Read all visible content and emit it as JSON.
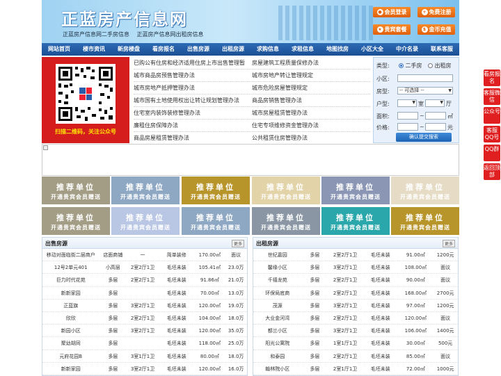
{
  "header": {
    "title": "正蓝房产信息网",
    "sublinks": [
      "正蓝房产信息网二手房信息",
      "正蓝房产信息网出租房信息"
    ],
    "buttons": [
      "会员登录",
      "免费注册",
      "贵宾套餐",
      "金币充值"
    ]
  },
  "nav": [
    "网站首页",
    "楼市资讯",
    "新房楼盘",
    "看房报名",
    "出售房源",
    "出租房源",
    "求购信息",
    "求租信息",
    "地图找房",
    "小区大全",
    "中介名录",
    "联系客服"
  ],
  "qr_caption": "扫描二维码，关注公众号",
  "links": [
    [
      "已购公有住房和经济适用住房上市出售管理暂",
      "房屋建筑工程质量保修办法"
    ],
    [
      "城市商品房预售管理办法",
      "城市房地产转让管理规定"
    ],
    [
      "城市房地产抵押管理办法",
      "城市危险房屋管理规定"
    ],
    [
      "城市国有土地使用权出让转让规划管理办法",
      "商品房销售管理办法"
    ],
    [
      "住宅室内装饰装修管理办法",
      "城市房屋租赁管理办法"
    ],
    [
      "廉租住房保障办法",
      "住宅专项维修资金管理办法"
    ],
    [
      "商品房屋租赁管理办法",
      "公共租赁住房管理办法"
    ]
  ],
  "search": {
    "type_label": "类型:",
    "radio1": "二手房",
    "radio2": "出租房",
    "community_label": "小区:",
    "layout_label": "房型:",
    "layout_value": "-- 可选择 --",
    "unit_label": "户型:",
    "unit_room": "室",
    "unit_hall": "厅",
    "area_label": "面积:",
    "area_unit": "㎡",
    "price_label": "价格:",
    "price_unit": "元",
    "range_sep": "~",
    "submit": "确认提交搜索"
  },
  "ads": {
    "line1": "推荐单位",
    "line2": "开通贵宾会员赠送"
  },
  "ad_colors": [
    "#a39d86",
    "#8ea8c4",
    "#b8952a",
    "#e2d3a8",
    "#8a96b4",
    "#e6dcc6",
    "#a39d86",
    "#b9c6e4",
    "#8ea8c4",
    "#8a96a4",
    "#2aa7aa",
    "#b8952a"
  ],
  "sale": {
    "title": "出售房源",
    "more": "更多",
    "rows": [
      [
        "移动对面临街二层商户",
        "店面商铺",
        "一",
        "简单装修",
        "170.00㎡",
        "面议"
      ],
      [
        "12号2单元401",
        "小高层",
        "2室2厅1卫",
        "毛坯未装",
        "105.41㎡",
        "23.0万"
      ],
      [
        "巨力时代花苑",
        "多层",
        "2室2厅1卫",
        "毛坯未装",
        "91.86㎡",
        "21.0万"
      ],
      [
        "新新家园",
        "多层",
        "",
        "毛坯未装",
        "70.00㎡",
        "13.0万"
      ],
      [
        "正蓝旗",
        "多层",
        "3室2厅1卫",
        "毛坯未装",
        "120.00㎡",
        "19.0万"
      ],
      [
        "欣欣",
        "多层",
        "2室2厅1卫",
        "毛坯未装",
        "104.00㎡",
        "18.0万"
      ],
      [
        "新园小区",
        "多层",
        "3室2厅1卫",
        "毛坯未装",
        "120.00㎡",
        "35.0万"
      ],
      [
        "聚幼胡同",
        "多层",
        "",
        "毛坯未装",
        "118.00㎡",
        "25.0万"
      ],
      [
        "元府花园B",
        "多层",
        "3室1厅1卫",
        "毛坯未装",
        "80.00㎡",
        "18.0万"
      ],
      [
        "新新家园",
        "多层",
        "3室2厅1卫",
        "毛坯未装",
        "120.00㎡",
        "16.0万"
      ]
    ]
  },
  "rent": {
    "title": "出租房源",
    "more": "更多",
    "rows": [
      [
        "世纪嘉园",
        "多层",
        "2室2厅1卫",
        "毛坯未装",
        "91.00㎡",
        "1200元"
      ],
      [
        "馨缘小区",
        "多层",
        "3室2厅1卫",
        "毛坯未装",
        "108.00㎡",
        "面议"
      ],
      [
        "千禧龙苑",
        "多层",
        "2室2厅1卫",
        "毛坯未装",
        "90.00㎡",
        "面议"
      ],
      [
        "环保局底商",
        "多层",
        "2室2厅1卫",
        "毛坯未装",
        "168.00㎡",
        "2700元"
      ],
      [
        "茂源",
        "多层",
        "3室2厅1卫",
        "毛坯未装",
        "97.00㎡",
        "1200元"
      ],
      [
        "大业金河湾",
        "多层",
        "2室2厅1卫",
        "毛坯未装",
        "120.00㎡",
        "面议"
      ],
      [
        "都兰小区",
        "多层",
        "3室2厅1卫",
        "毛坯未装",
        "106.00㎡",
        "1400元"
      ],
      [
        "阳光公寓院",
        "多层",
        "1室1厅1卫",
        "毛坯未装",
        "30.00㎡",
        "500元"
      ],
      [
        "和泰园",
        "多层",
        "2室2厅1卫",
        "毛坯未装",
        "85.00㎡",
        "面议"
      ],
      [
        "翰林院小区",
        "多层",
        "2室1厅1卫",
        "毛坯未装",
        "72.00㎡",
        "1000元"
      ]
    ]
  },
  "side": [
    "看房报名",
    "客服微信",
    "公众号",
    "客服QQ号",
    "QQ群",
    "返回顶部"
  ]
}
